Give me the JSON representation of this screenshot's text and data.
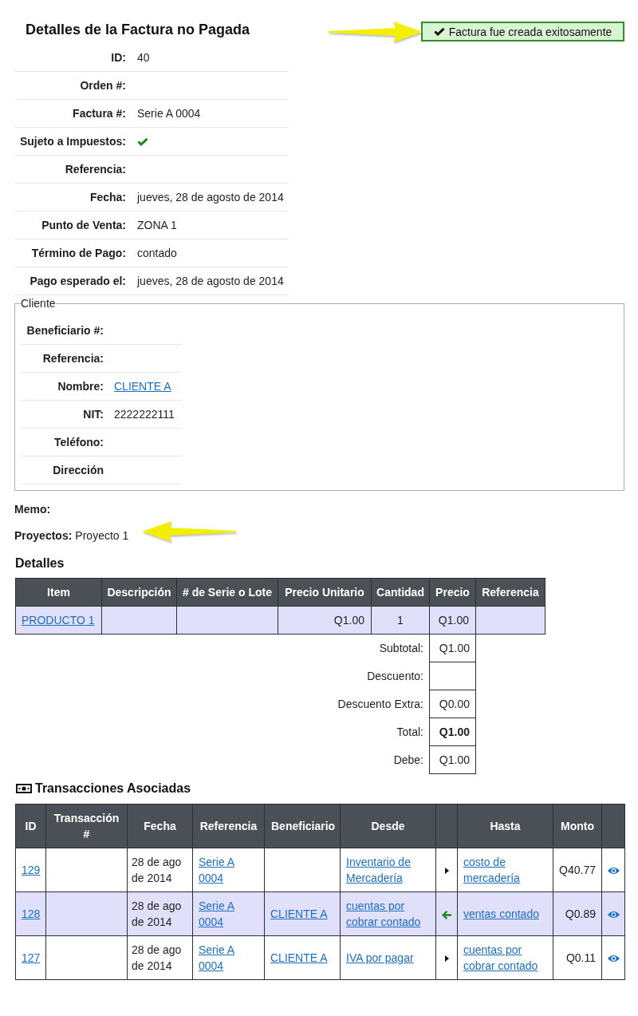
{
  "invoice": {
    "title": "Detalles de la Factura no Pagada",
    "fields": [
      {
        "label": "ID:",
        "kind": "text",
        "value": "40"
      },
      {
        "label": "Orden #:",
        "kind": "text"
      },
      {
        "label": "Factura #:",
        "kind": "text",
        "value": "Serie A 0004"
      },
      {
        "label": "Sujeto a Impuestos:",
        "kind": "check",
        "checked": true
      },
      {
        "label": "Referencia:",
        "kind": "text"
      },
      {
        "label": "Fecha:",
        "kind": "text",
        "value": "jueves, 28 de agosto de 2014"
      },
      {
        "label": "Punto de Venta:",
        "kind": "text",
        "value": "ZONA 1"
      },
      {
        "label": "Término de Pago:",
        "kind": "text",
        "value": "contado"
      },
      {
        "label": "Pago esperado el:",
        "kind": "text",
        "value": "jueves, 28 de agosto de 2014"
      }
    ]
  },
  "alert": {
    "text": "Factura fue creada exitosamente",
    "pointer": true
  },
  "client": {
    "legend": "Cliente",
    "fields": [
      {
        "label": "Beneficiario #:",
        "kind": "text"
      },
      {
        "label": "Referencia:",
        "kind": "text"
      },
      {
        "label": "Nombre:",
        "kind": "link",
        "value": "CLIENTE A"
      },
      {
        "label": "NIT:",
        "kind": "text",
        "value": "2222222111"
      },
      {
        "label": "Teléfono:",
        "kind": "text"
      },
      {
        "label": "Dirección",
        "kind": "text"
      }
    ]
  },
  "memo": {
    "label": "Memo:"
  },
  "projects": {
    "label": "Proyectos:",
    "value": "Proyecto 1",
    "pointer": true
  },
  "details": {
    "title": "Detalles",
    "columns": [
      "Item",
      "Descripción",
      "# de Serie o Lote",
      "Precio Unitario",
      "Cantidad",
      "Precio",
      "Referencia"
    ],
    "rows": [
      {
        "highlighted": true,
        "item": "PRODUCTO 1",
        "unit_price": "Q1.00",
        "quantity": "1",
        "price": "Q1.00"
      }
    ],
    "summary": [
      {
        "label": "Subtotal:",
        "value": "Q1.00",
        "emphasized": false
      },
      {
        "label": "Descuento:"
      },
      {
        "label": "Descuento Extra:",
        "value": "Q0.00",
        "emphasized": false
      },
      {
        "label": "Total:",
        "value": "Q1.00",
        "emphasized": true
      },
      {
        "label": "Debe:",
        "value": "Q1.00",
        "emphasized": false
      }
    ]
  },
  "transactions": {
    "title": "Transacciones Asociadas",
    "columns": [
      "ID",
      "Transacción #",
      "Fecha",
      "Referencia",
      "Beneficiario",
      "Desde",
      "Hasta",
      "Monto"
    ],
    "rows": [
      {
        "kind": "forward",
        "highlighted": false,
        "id": "129",
        "date": "28 de ago de 2014",
        "reference": "Serie A 0004",
        "from": "Inventario de Mercadería",
        "to": "costo de mercadería",
        "amount": "Q40.77"
      },
      {
        "kind": "reverse",
        "highlighted": true,
        "id": "128",
        "date": "28 de ago de 2014",
        "reference": "Serie A 0004",
        "beneficiary": "CLIENTE A",
        "from": "cuentas por cobrar contado",
        "to": "ventas contado",
        "amount": "Q0.89"
      },
      {
        "kind": "forward",
        "highlighted": false,
        "id": "127",
        "date": "28 de ago de 2014",
        "reference": "Serie A 0004",
        "beneficiary": "CLIENTE A",
        "from": "IVA por pagar",
        "to": "cuentas por cobrar contado",
        "amount": "Q0.11"
      }
    ]
  }
}
